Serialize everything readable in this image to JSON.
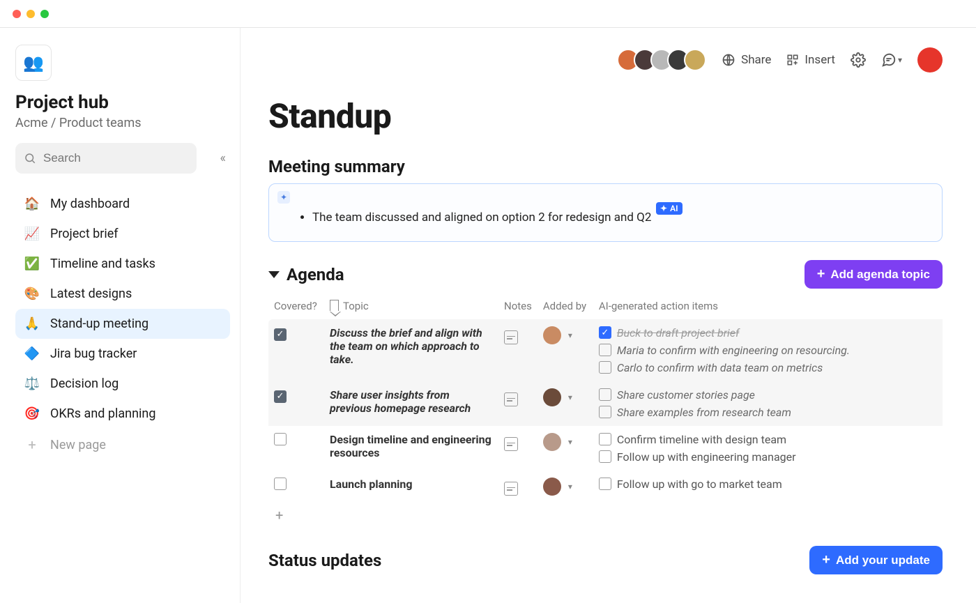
{
  "workspace": {
    "title": "Project hub",
    "breadcrumb": "Acme / Product teams",
    "search_placeholder": "Search"
  },
  "sidebar": {
    "items": [
      {
        "icon": "🏠",
        "label": "My dashboard"
      },
      {
        "icon": "📈",
        "label": "Project brief"
      },
      {
        "icon": "✅",
        "label": "Timeline and tasks"
      },
      {
        "icon": "🎨",
        "label": "Latest designs"
      },
      {
        "icon": "🙏",
        "label": "Stand-up meeting"
      },
      {
        "icon": "🔷",
        "label": "Jira bug tracker"
      },
      {
        "icon": "⚖️",
        "label": "Decision log"
      },
      {
        "icon": "🎯",
        "label": "OKRs and planning"
      }
    ],
    "new_page_label": "New page"
  },
  "toolbar": {
    "share_label": "Share",
    "insert_label": "Insert"
  },
  "page": {
    "title": "Standup",
    "summary_heading": "Meeting summary",
    "summary_bullet": "The team discussed and aligned on option 2 for redesign and Q2",
    "ai_badge": "AI",
    "agenda_heading": "Agenda",
    "add_agenda_label": "Add agenda topic",
    "status_heading": "Status updates",
    "add_update_label": "Add your update"
  },
  "agenda": {
    "columns": {
      "covered": "Covered?",
      "topic": "Topic",
      "notes": "Notes",
      "added_by": "Added by",
      "ai_items": "AI-generated action items"
    },
    "rows": [
      {
        "covered": true,
        "topic": "Discuss the brief and align with the team on which approach to take.",
        "italic": true,
        "shaded": true,
        "avatar_color": "#c98b63",
        "ai_items": [
          {
            "checked": true,
            "text": "Buck to draft project brief",
            "strike": true
          },
          {
            "checked": false,
            "text": "Maria to confirm with engineering on resourcing.",
            "italic": true
          },
          {
            "checked": false,
            "text": "Carlo to confirm with data team on metrics",
            "italic": true
          }
        ]
      },
      {
        "covered": true,
        "topic": "Share user insights from previous homepage research",
        "italic": true,
        "shaded": true,
        "avatar_color": "#6b4b3a",
        "ai_items": [
          {
            "checked": false,
            "text": "Share customer stories page",
            "italic": true
          },
          {
            "checked": false,
            "text": "Share examples from research team",
            "italic": true
          }
        ]
      },
      {
        "covered": false,
        "topic": "Design timeline and engineering resources",
        "italic": false,
        "shaded": false,
        "avatar_color": "#b89a8a",
        "ai_items": [
          {
            "checked": false,
            "text": "Confirm timeline with design team"
          },
          {
            "checked": false,
            "text": "Follow up with engineering manager"
          }
        ]
      },
      {
        "covered": false,
        "topic": "Launch planning",
        "italic": false,
        "shaded": false,
        "avatar_color": "#8a5a4a",
        "ai_items": [
          {
            "checked": false,
            "text": "Follow up with go to market team"
          }
        ]
      }
    ]
  },
  "presence": {
    "avatar_colors": [
      "#d66b3a",
      "#4a3a3a",
      "#b8b8b8",
      "#3a3a3a",
      "#c9a85a"
    ]
  }
}
